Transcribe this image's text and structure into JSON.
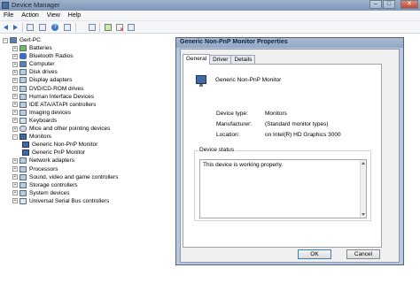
{
  "window": {
    "title": "Device Manager",
    "min": "–",
    "max": "□",
    "close": "✕"
  },
  "menu": [
    "File",
    "Action",
    "View",
    "Help"
  ],
  "tree": {
    "root": "Gert-PC",
    "items": [
      {
        "label": "Batteries",
        "icon": "battery-icon",
        "exp": "+"
      },
      {
        "label": "Bluetooth Radios",
        "icon": "bluetooth-icon",
        "exp": "+"
      },
      {
        "label": "Computer",
        "icon": "computer-icon",
        "exp": "+"
      },
      {
        "label": "Disk drives",
        "icon": "disk-drive-icon",
        "exp": "+"
      },
      {
        "label": "Display adapters",
        "icon": "display-adapter-icon",
        "exp": "+"
      },
      {
        "label": "DVD/CD-ROM drives",
        "icon": "dvd-drive-icon",
        "exp": "+"
      },
      {
        "label": "Human Interface Devices",
        "icon": "hid-icon",
        "exp": "+"
      },
      {
        "label": "IDE ATA/ATAPI controllers",
        "icon": "ide-controller-icon",
        "exp": "+"
      },
      {
        "label": "Imaging devices",
        "icon": "camera-icon",
        "exp": "+"
      },
      {
        "label": "Keyboards",
        "icon": "keyboard-icon",
        "exp": "+"
      },
      {
        "label": "Mice and other pointing devices",
        "icon": "mouse-icon",
        "exp": "+"
      },
      {
        "label": "Monitors",
        "icon": "monitor-icon",
        "exp": "-"
      },
      {
        "label": "Generic Non-PnP Monitor",
        "icon": "monitor-icon",
        "child": true
      },
      {
        "label": "Generic PnP Monitor",
        "icon": "monitor-icon",
        "child": true
      },
      {
        "label": "Network adapters",
        "icon": "network-adapter-icon",
        "exp": "+"
      },
      {
        "label": "Processors",
        "icon": "processor-icon",
        "exp": "+"
      },
      {
        "label": "Sound, video and game controllers",
        "icon": "sound-icon",
        "exp": "+"
      },
      {
        "label": "Storage controllers",
        "icon": "storage-icon",
        "exp": "+"
      },
      {
        "label": "System devices",
        "icon": "system-icon",
        "exp": "+"
      },
      {
        "label": "Universal Serial Bus controllers",
        "icon": "usb-icon",
        "exp": "+"
      }
    ]
  },
  "dialog": {
    "title": "Generic Non-PnP Monitor Properties",
    "tabs": [
      "General",
      "Driver",
      "Details"
    ],
    "device_name": "Generic Non-PnP Monitor",
    "props": [
      {
        "label": "Device type:",
        "value": "Monitors"
      },
      {
        "label": "Manufacturer:",
        "value": "(Standard monitor types)"
      },
      {
        "label": "Location:",
        "value": "on Intel(R) HD Graphics 3000"
      }
    ],
    "status_label": "Device status",
    "status_text": "This device is working properly.",
    "ok": "OK",
    "cancel": "Cancel"
  }
}
